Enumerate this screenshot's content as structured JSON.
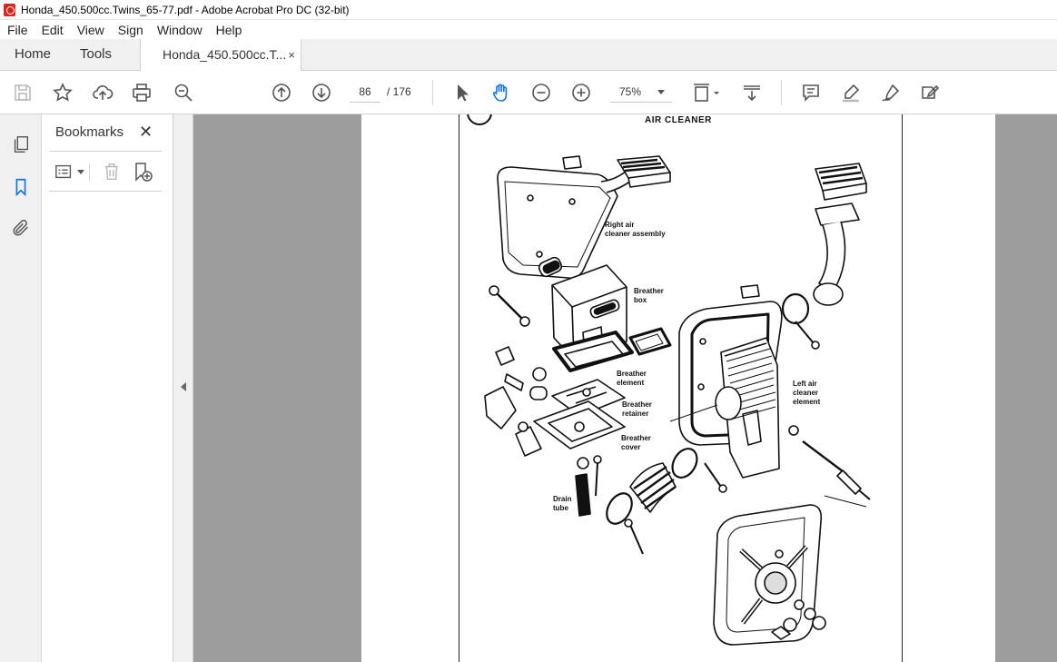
{
  "window": {
    "title": "Honda_450.500cc.Twins_65-77.pdf - Adobe Acrobat Pro DC (32-bit)"
  },
  "menu": [
    "File",
    "Edit",
    "View",
    "Sign",
    "Window",
    "Help"
  ],
  "tabs": {
    "home": "Home",
    "tools": "Tools",
    "document": "Honda_450.500cc.T...",
    "close": "×"
  },
  "toolbar": {
    "page_current": "86",
    "page_total": "/ 176",
    "zoom": "75%"
  },
  "bookmarks": {
    "title": "Bookmarks",
    "close": "✕"
  },
  "document": {
    "heading": "AIR  CLEANER",
    "labels": {
      "right_air_1": "Right air",
      "right_air_2": "cleaner assembly",
      "breather_box_1": "Breather",
      "breather_box_2": "box",
      "breather_element_1": "Breather",
      "breather_element_2": "element",
      "breather_retainer_1": "Breather",
      "breather_retainer_2": "retainer",
      "breather_cover_1": "Breather",
      "breather_cover_2": "cover",
      "drain_tube_1": "Drain",
      "drain_tube_2": "tube",
      "left_air_1": "Left air",
      "left_air_2": "cleaner",
      "left_air_3": "element"
    }
  }
}
